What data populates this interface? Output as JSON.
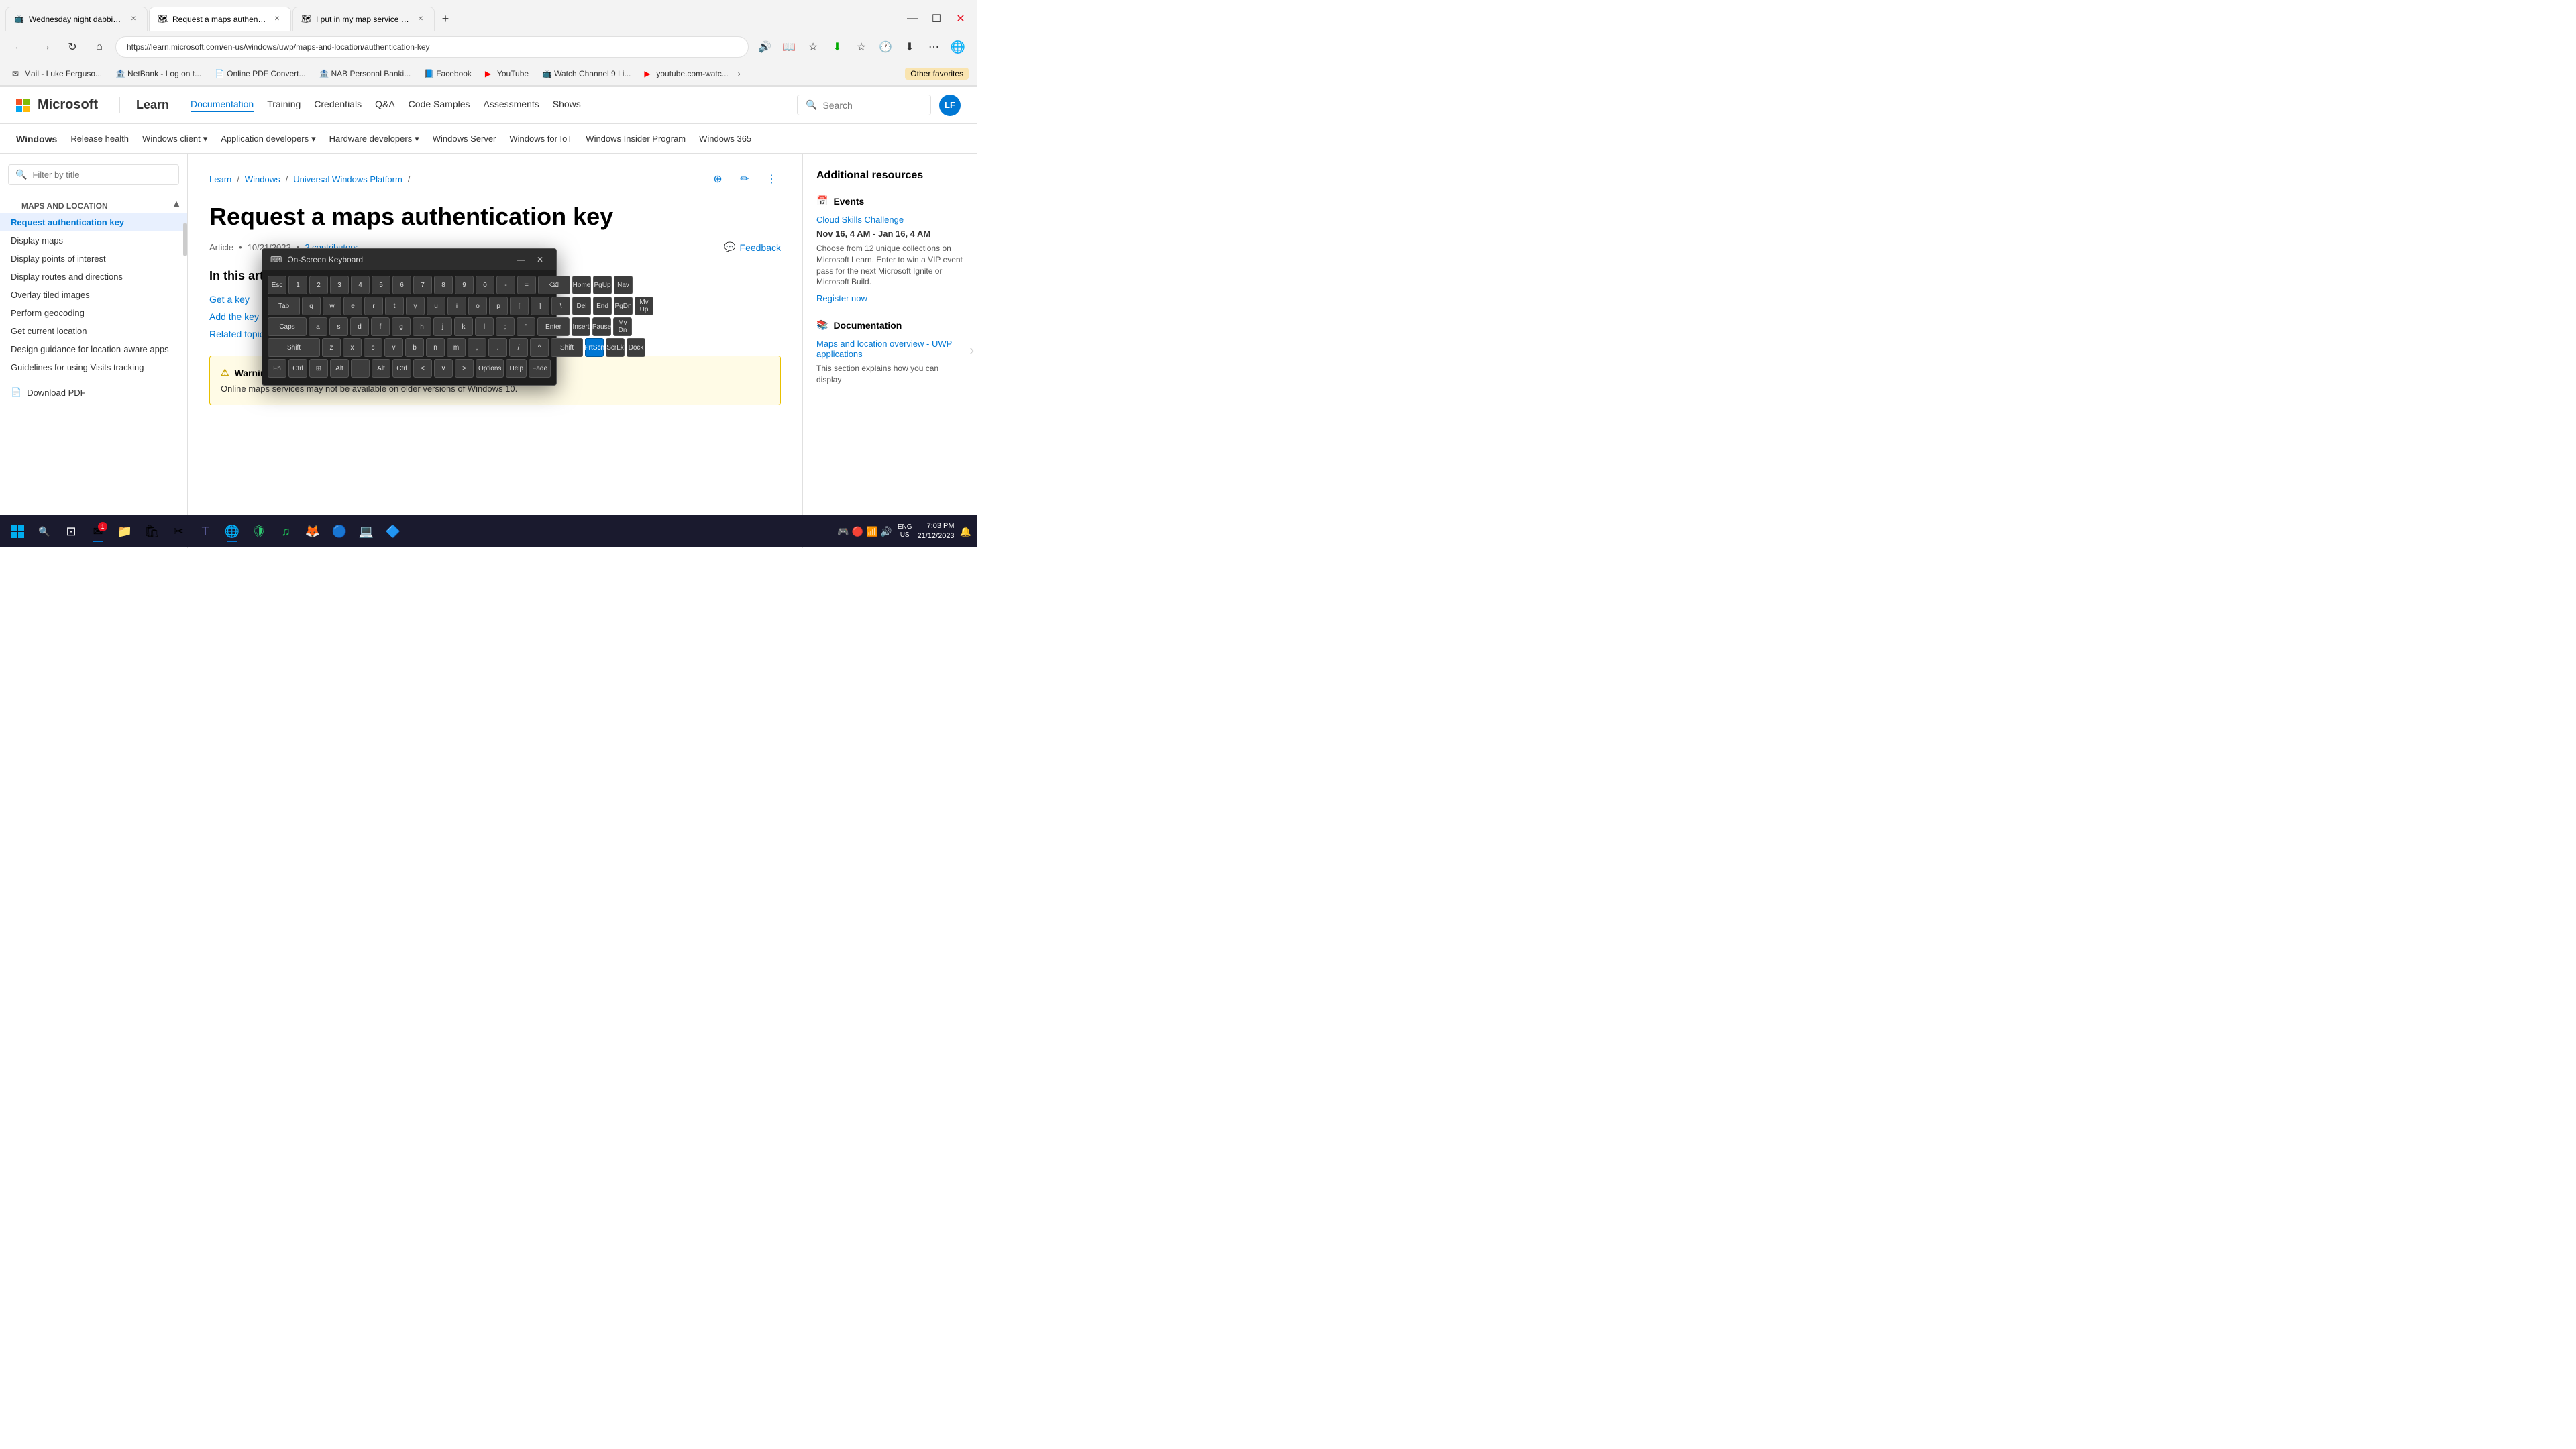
{
  "browser": {
    "tabs": [
      {
        "id": "tab1",
        "favicon": "📺",
        "title": "Wednesday night dabbing time...",
        "active": false,
        "color": "#ff0000"
      },
      {
        "id": "tab2",
        "favicon": "🗺",
        "title": "Request a maps authentication k...",
        "active": true,
        "color": "#0078d4"
      },
      {
        "id": "tab3",
        "favicon": "🗺",
        "title": "I put in my map service token ke...",
        "active": false,
        "color": "#0078d4"
      }
    ],
    "address": "https://learn.microsoft.com/en-us/windows/uwp/maps-and-location/authentication-key",
    "bookmarks": [
      {
        "favicon": "✉",
        "label": "Mail - Luke Ferguso..."
      },
      {
        "favicon": "🏦",
        "label": "NetBank - Log on t..."
      },
      {
        "favicon": "📄",
        "label": "Online PDF Convert..."
      },
      {
        "favicon": "🏦",
        "label": "NAB Personal Banki..."
      },
      {
        "favicon": "📘",
        "label": "Facebook"
      },
      {
        "favicon": "▶",
        "label": "YouTube"
      },
      {
        "favicon": "📺",
        "label": "Watch Channel 9 Li..."
      },
      {
        "favicon": "▶",
        "label": "youtube.com-watc..."
      }
    ],
    "other_favs": "Other favorites"
  },
  "ms_header": {
    "logo": "Microsoft",
    "learn": "Learn",
    "nav": [
      "Documentation",
      "Training",
      "Credentials",
      "Q&A",
      "Code Samples",
      "Assessments",
      "Shows"
    ],
    "active_nav": "Documentation",
    "search_placeholder": "Search",
    "avatar": "LF"
  },
  "windows_nav": {
    "items": [
      "Windows",
      "Release health",
      "Windows client",
      "Application developers",
      "Hardware developers",
      "Windows Server",
      "Windows for IoT",
      "Windows Insider Program",
      "Windows 365"
    ]
  },
  "sidebar": {
    "filter_placeholder": "Filter by title",
    "section": "Maps and location",
    "items": [
      {
        "label": "Request authentication key",
        "active": true
      },
      {
        "label": "Display maps"
      },
      {
        "label": "Display points of interest"
      },
      {
        "label": "Display routes and directions"
      },
      {
        "label": "Overlay tiled images"
      },
      {
        "label": "Perform geocoding"
      },
      {
        "label": "Get current location"
      },
      {
        "label": "Design guidance for location-aware apps"
      },
      {
        "label": "Guidelines for using Visits tracking"
      }
    ],
    "download_pdf": "Download PDF"
  },
  "breadcrumb": {
    "items": [
      "Learn",
      "Windows",
      "Universal Windows Platform"
    ],
    "separator": "/"
  },
  "article": {
    "title": "Request a maps authentication key",
    "type": "Article",
    "date": "10/21/2022",
    "contributors": "2 contributors",
    "feedback": "Feedback",
    "in_this_article": "In this article",
    "links": [
      "Get a key",
      "Add the key to your app",
      "Related topics"
    ],
    "warning_title": "Warning",
    "warning_text": "Online maps services may not be available on older versions of Windows 10."
  },
  "resources": {
    "title": "Additional resources",
    "events_section": "Events",
    "events_link": "Cloud Skills Challenge",
    "events_date": "Nov 16, 4 AM - Jan 16, 4 AM",
    "events_desc": "Choose from 12 unique collections on Microsoft Learn. Enter to win a VIP event pass for the next Microsoft Ignite or Microsoft Build.",
    "events_register": "Register now",
    "docs_section": "Documentation",
    "docs_link": "Maps and location overview - UWP applications",
    "docs_desc": "This section explains how you can display"
  },
  "osk": {
    "title": "On-Screen Keyboard",
    "rows": [
      [
        "Esc",
        "1",
        "2",
        "3",
        "4",
        "5",
        "6",
        "7",
        "8",
        "9",
        "0",
        "-",
        "=",
        "⌫",
        "Home",
        "PgUp",
        "Nav"
      ],
      [
        "Tab",
        "q",
        "w",
        "e",
        "r",
        "t",
        "y",
        "u",
        "i",
        "o",
        "p",
        "[",
        "]",
        "\\",
        "Del",
        "End",
        "PgDn",
        "Mv Up"
      ],
      [
        "Caps",
        "a",
        "s",
        "d",
        "f",
        "g",
        "h",
        "j",
        "k",
        "l",
        ";",
        "'",
        "Enter",
        "",
        "Insert",
        "Pause",
        "Mv Dn"
      ],
      [
        "Shift",
        "z",
        "x",
        "c",
        "v",
        "b",
        "n",
        "m",
        ",",
        ".",
        "/",
        "^",
        "Shift",
        "PrtScn",
        "ScrLk",
        "Dock"
      ],
      [
        "Fn",
        "Ctrl",
        "⊞",
        "Alt",
        "",
        "",
        "",
        "",
        "",
        "Alt",
        "Ctrl",
        "<",
        "∨",
        ">",
        "Options",
        "Help",
        "Fade"
      ]
    ]
  },
  "taskbar": {
    "icons": [
      {
        "name": "start",
        "symbol": "⊞",
        "badge": null
      },
      {
        "name": "search",
        "symbol": "🔍",
        "badge": null
      },
      {
        "name": "task-view",
        "symbol": "⊡",
        "badge": null
      },
      {
        "name": "mail",
        "symbol": "✉",
        "badge": "1"
      },
      {
        "name": "explorer",
        "symbol": "📁",
        "badge": null
      },
      {
        "name": "store",
        "symbol": "🛍",
        "badge": null
      },
      {
        "name": "windows-security",
        "symbol": "🛡",
        "badge": null
      },
      {
        "name": "teams",
        "symbol": "💬",
        "badge": null
      },
      {
        "name": "edge",
        "symbol": "🌐",
        "badge": null
      },
      {
        "name": "chrome",
        "symbol": "🔵",
        "badge": null
      },
      {
        "name": "spotify",
        "symbol": "♫",
        "badge": null
      },
      {
        "name": "app1",
        "symbol": "🦊",
        "badge": null
      },
      {
        "name": "app2",
        "symbol": "🎨",
        "badge": null
      },
      {
        "name": "app3",
        "symbol": "💻",
        "badge": null
      }
    ],
    "tray": {
      "time": "7:03 PM",
      "date": "21/12/2023",
      "lang": "ENG\nUS"
    }
  }
}
